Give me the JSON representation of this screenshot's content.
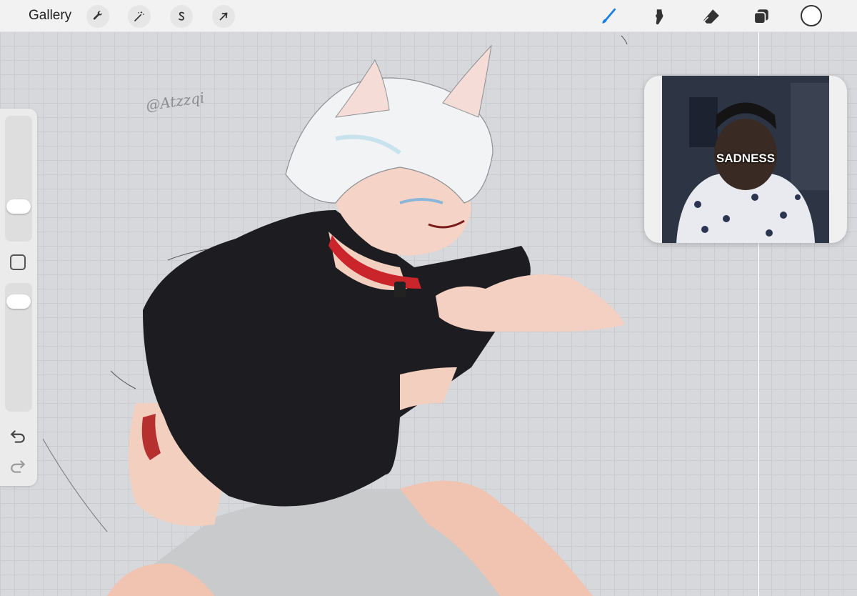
{
  "toolbar": {
    "gallery_label": "Gallery",
    "left_tools": [
      {
        "name": "actions",
        "icon": "wrench-icon"
      },
      {
        "name": "adjustments",
        "icon": "magic-wand-icon"
      },
      {
        "name": "selection",
        "icon": "selection-s-icon"
      },
      {
        "name": "transform",
        "icon": "arrow-cursor-icon"
      }
    ],
    "right_tools": [
      {
        "name": "brush",
        "icon": "brush-icon",
        "active": true
      },
      {
        "name": "smudge",
        "icon": "smudge-icon"
      },
      {
        "name": "eraser",
        "icon": "eraser-icon"
      },
      {
        "name": "layers",
        "icon": "layers-icon"
      }
    ],
    "current_color": "#ffffff",
    "active_color": "#1a7fe0"
  },
  "sidebar": {
    "brush_size_level": 0.25,
    "opacity_level": 0.9,
    "modify_icon": "square-icon",
    "undo_icon": "undo-icon",
    "redo_icon": "redo-icon"
  },
  "canvas": {
    "signature": "@Atzzqi"
  },
  "pip": {
    "caption": "SADNESS"
  }
}
